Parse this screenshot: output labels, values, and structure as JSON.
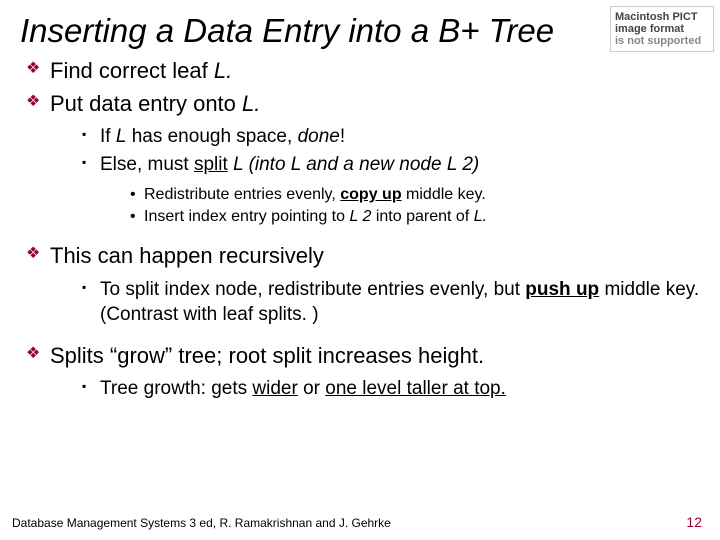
{
  "title_html": "Inserting a Data Entry into a B+ Tree",
  "missing_img": {
    "l1": "Macintosh PICT",
    "l2": "image format",
    "l3": "is not supported"
  },
  "b1_html": "Find correct leaf <span class='i'>L.</span>",
  "b2_html": "Put data entry onto <span class='i'>L.</span>",
  "b2s1_html": "If <span class='i'>L</span> has enough space, <span class='i'>done</span>!",
  "b2s2_html": "Else, must <span class='u'>split</span>  <span class='i'>L (into L and a new node L 2)</span>",
  "b2s2a_html": "Redistribute entries evenly, <span class='b u'>copy up</span> middle key.",
  "b2s2b_html": "Insert index entry pointing to <span class='i'>L 2</span> into parent of <span class='i'>L.</span>",
  "b3_html": "This can happen recursively",
  "b3s1_html": "To split index node, redistribute entries evenly, but <span class='b u'>push up</span> middle key.  (Contrast with leaf splits. )",
  "b4_html": "Splits “grow” tree; root split increases height.",
  "b4s1_html": "Tree growth: gets <span class='u'>wider</span> or <span class='u'>one level taller at top.</span>",
  "footer": "Database Management Systems 3 ed,  R. Ramakrishnan and J. Gehrke",
  "page": "12"
}
